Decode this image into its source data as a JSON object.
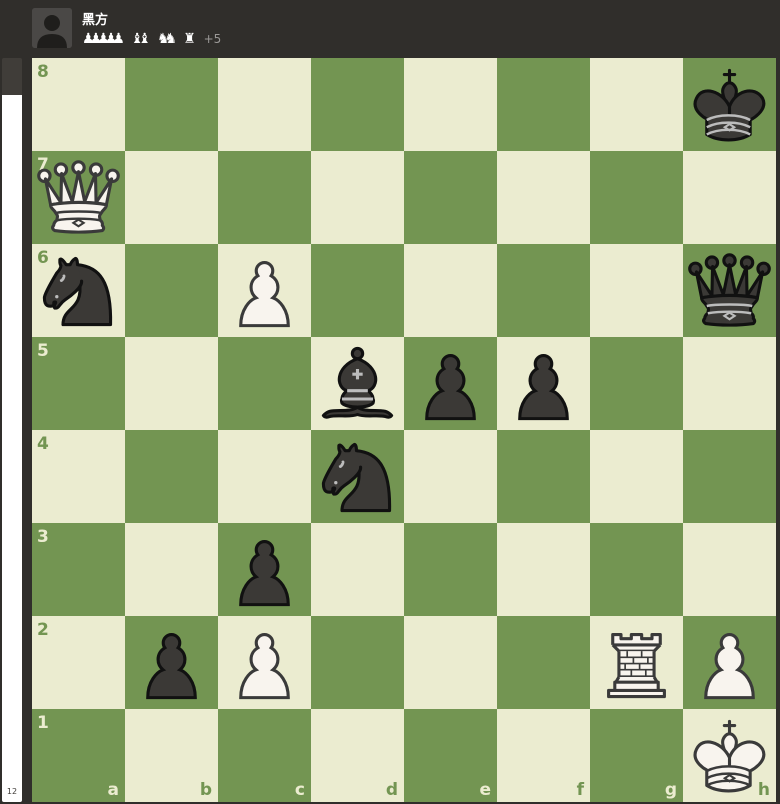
{
  "player": {
    "name": "黑方",
    "advantage": "+5",
    "captured": [
      {
        "type": "pawn",
        "count": 5
      },
      {
        "type": "bishop",
        "count": 2
      },
      {
        "type": "knight",
        "count": 2
      },
      {
        "type": "rook",
        "count": 1
      }
    ]
  },
  "eval": {
    "label": "12",
    "white_fraction": 0.95
  },
  "board": {
    "files": [
      "a",
      "b",
      "c",
      "d",
      "e",
      "f",
      "g",
      "h"
    ],
    "ranks": [
      "8",
      "7",
      "6",
      "5",
      "4",
      "3",
      "2",
      "1"
    ],
    "light_color": "#ebecd0",
    "dark_color": "#739552",
    "pieces": [
      {
        "square": "h8",
        "color": "black",
        "type": "king"
      },
      {
        "square": "a7",
        "color": "white",
        "type": "queen"
      },
      {
        "square": "a6",
        "color": "black",
        "type": "knight"
      },
      {
        "square": "c6",
        "color": "white",
        "type": "pawn"
      },
      {
        "square": "h6",
        "color": "black",
        "type": "queen"
      },
      {
        "square": "d5",
        "color": "black",
        "type": "bishop"
      },
      {
        "square": "e5",
        "color": "black",
        "type": "pawn"
      },
      {
        "square": "f5",
        "color": "black",
        "type": "pawn"
      },
      {
        "square": "d4",
        "color": "black",
        "type": "knight"
      },
      {
        "square": "c3",
        "color": "black",
        "type": "pawn"
      },
      {
        "square": "b2",
        "color": "black",
        "type": "pawn"
      },
      {
        "square": "c2",
        "color": "white",
        "type": "pawn"
      },
      {
        "square": "g2",
        "color": "white",
        "type": "rook"
      },
      {
        "square": "h2",
        "color": "white",
        "type": "pawn"
      },
      {
        "square": "h1",
        "color": "white",
        "type": "king"
      }
    ]
  }
}
